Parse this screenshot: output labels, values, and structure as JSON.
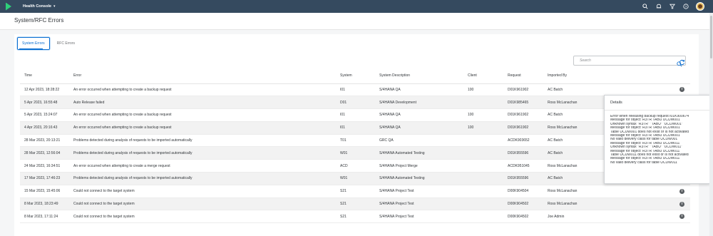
{
  "shell": {
    "title": "Health Console",
    "icons": [
      "search-icon",
      "bell-icon",
      "filter-icon",
      "help-icon",
      "user-avatar"
    ],
    "colors": {
      "shell_bg": "#354a5f",
      "accent": "#0a6ed1",
      "logo": "#2ecf7a"
    }
  },
  "page": {
    "title": "System/RFC Errors"
  },
  "tabs": [
    {
      "label": "System Errors",
      "active": true
    },
    {
      "label": "RFC Errors",
      "active": false
    }
  ],
  "search": {
    "placeholder": "Search"
  },
  "table": {
    "headers": {
      "time": "Time",
      "error": "Error",
      "system": "System",
      "description": "System Description",
      "client": "Client",
      "request": "Request",
      "imported_by": "Imported By"
    },
    "rows": [
      {
        "time": "12 Apr 2023, 18:28:22",
        "error": "An error occurred when attempting to create a backup request",
        "system": "I01",
        "description": "S/4HANA QA",
        "client": "100",
        "request": "D01K961902",
        "imported_by": "AC Batch"
      },
      {
        "time": "5 Apr 2023, 16:55:48",
        "error": "Auto Release failed",
        "system": "D01",
        "description": "S/4HANA Development",
        "client": "",
        "request": "D01K985465",
        "imported_by": "Ross McLanachan"
      },
      {
        "time": "5 Apr 2023, 15:24:07",
        "error": "An error occurred when attempting to create a backup request",
        "system": "I01",
        "description": "S/4HANA QA",
        "client": "100",
        "request": "D01K961902",
        "imported_by": "AC Batch"
      },
      {
        "time": "4 Apr 2023, 20:16:43",
        "error": "An error occurred when attempting to create a backup request",
        "system": "I01",
        "description": "S/4HANA QA",
        "client": "100",
        "request": "D01K961902",
        "imported_by": "Ross McLanachan"
      },
      {
        "time": "28 Mar 2023, 20:13:21",
        "error": "Problems detected during analysis of requests to be imported automatically",
        "system": "T01",
        "description": "GRC QA",
        "client": "",
        "request": "ACDK903652",
        "imported_by": "AC Batch"
      },
      {
        "time": "28 Mar 2023, 12:56:04",
        "error": "Problems detected during analysis of requests to be imported automatically",
        "system": "W01",
        "description": "S/4HANA Automated Testing",
        "client": "",
        "request": "D01K955596",
        "imported_by": "AC Batch"
      },
      {
        "time": "24 Mar 2023, 16:34:51",
        "error": "An error occurred when attempting to create a merge request",
        "system": "ACD",
        "description": "S/4HANA Project Merge",
        "client": "",
        "request": "ACDK951045",
        "imported_by": "Ross McLanachan"
      },
      {
        "time": "17 Mar 2023, 17:46:23",
        "error": "Problems detected during analysis of requests to be imported automatically",
        "system": "W01",
        "description": "S/4HANA Automated Testing",
        "client": "",
        "request": "D01K955596",
        "imported_by": "AC Batch"
      },
      {
        "time": "15 Mar 2023, 15:45:06",
        "error": "Could not connect to the target system",
        "system": "S21",
        "description": "S/4HANA Project Test",
        "client": "",
        "request": "D00K904504",
        "imported_by": "Ross McLanachan"
      },
      {
        "time": "8 Mar 2023, 18:23:49",
        "error": "Could not connect to the target system",
        "system": "S21",
        "description": "S/4HANA Project Test",
        "client": "",
        "request": "D00K904502",
        "imported_by": "Ross McLanachan"
      },
      {
        "time": "8 Mar 2023, 17:11:24",
        "error": "Could not connect to the target system",
        "system": "S21",
        "description": "S/4HANA Project Test",
        "client": "",
        "request": "D00K904502",
        "imported_by": "Joe Admin"
      }
    ]
  },
  "popover": {
    "title": "Details",
    "lines": [
      "Error when releasing backup request I01K900674",
      "Message for object: R3TR TABU UCUW001",
      "Unknown syntax \"R3TR\" \"TABU\" \"UCUW001\"",
      "Message for object: R3TR TABU UCUW001",
      "Table UCUW001 does not exist or is not activated",
      "Message for object: R3TR TABU UCUW001",
      "No valid delivery class for table UCUW001",
      "Message for object: R3TR TABU UCUW011",
      "Unknown syntax \"R3TR\" \"TABU\" \"UCUW011\"",
      "Message for object: R3TR TABU UCUW011",
      "Table UCUW011 does not exist or is not activated",
      "Message for object: R3TR TABU UCUW011",
      "No valid delivery class for table UCUW011"
    ]
  }
}
